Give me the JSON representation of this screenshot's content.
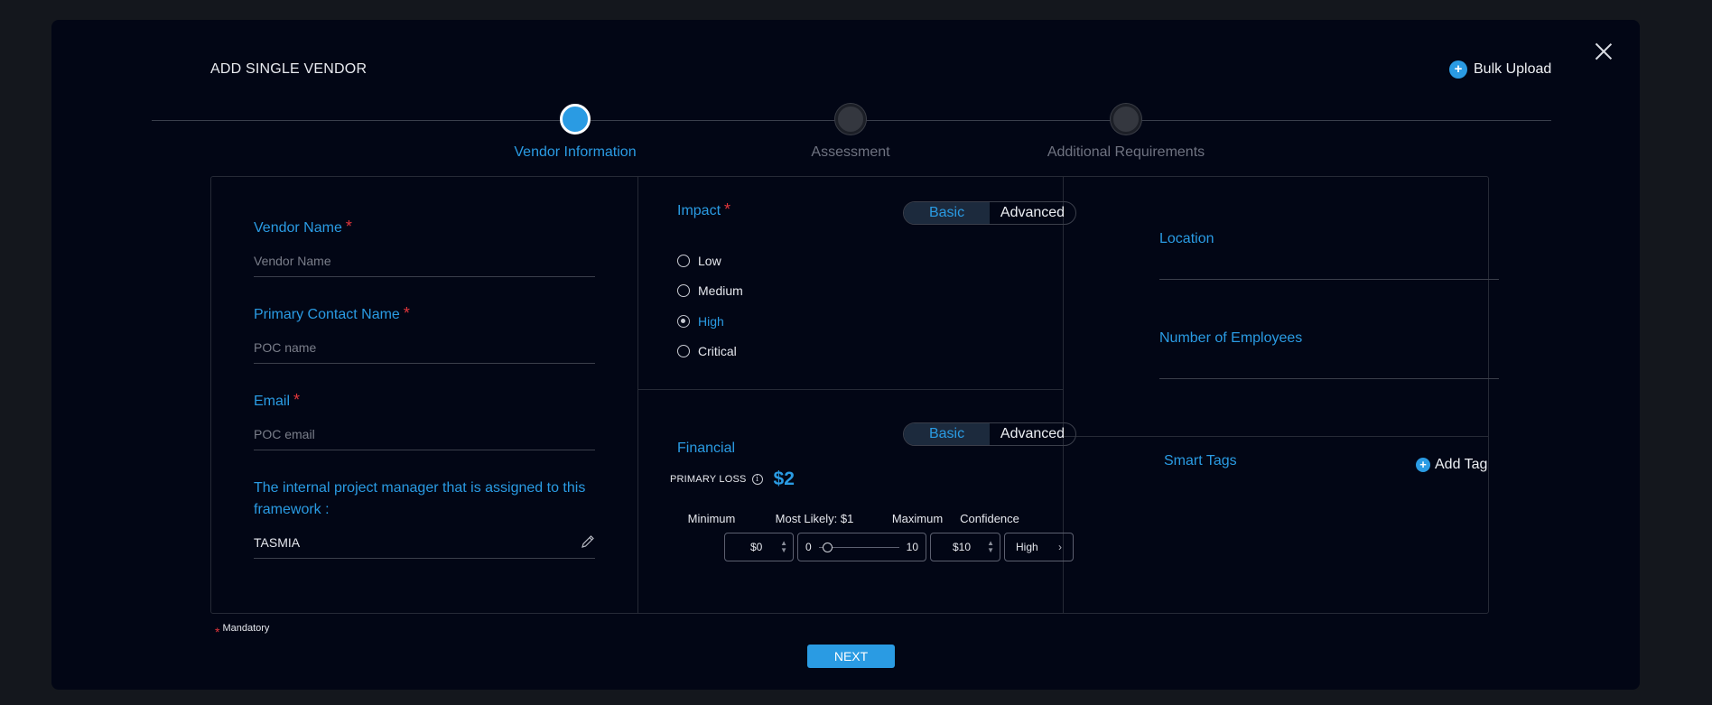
{
  "modal": {
    "title": "ADD SINGLE VENDOR",
    "bulk_upload_label": "Bulk Upload"
  },
  "steps": [
    {
      "label": "Vendor Information",
      "active": true
    },
    {
      "label": "Assessment",
      "active": false
    },
    {
      "label": "Additional Requirements",
      "active": false
    }
  ],
  "vendor": {
    "name_label": "Vendor Name",
    "name_placeholder": "Vendor Name",
    "poc_label": "Primary Contact Name",
    "poc_placeholder": "POC name",
    "email_label": "Email",
    "email_placeholder": "POC email",
    "pm_label": "The internal project manager that is assigned to this framework :",
    "pm_value": "TASMIA",
    "required_marker": "*"
  },
  "impact": {
    "label": "Impact",
    "toggle_basic": "Basic",
    "toggle_advanced": "Advanced",
    "selected_toggle": "Basic",
    "options": [
      "Low",
      "Medium",
      "High",
      "Critical"
    ],
    "selected": "High"
  },
  "financial": {
    "label": "Financial",
    "toggle_basic": "Basic",
    "toggle_advanced": "Advanced",
    "selected_toggle": "Basic",
    "primary_loss_label": "PRIMARY LOSS",
    "primary_loss_value": "$2",
    "info_icon": "info-icon",
    "minimum_label": "Minimum",
    "most_likely_label": "Most Likely: $1",
    "maximum_label": "Maximum",
    "confidence_label": "Confidence",
    "minimum_value": "$0",
    "slider_min": "0",
    "slider_max": "10",
    "slider_value_fraction": 0.1,
    "maximum_value": "$10",
    "confidence_value": "High"
  },
  "right": {
    "location_label": "Location",
    "employees_label": "Number of Employees",
    "smart_tags_label": "Smart Tags",
    "add_tag_label": "Add Tag"
  },
  "footer": {
    "mandatory_label": "Mandatory",
    "required_marker": "*",
    "next_label": "NEXT"
  },
  "colors": {
    "accent": "#2a9be3",
    "required": "#e2363b",
    "modal_bg": "#020615",
    "page_bg": "#14171d"
  }
}
